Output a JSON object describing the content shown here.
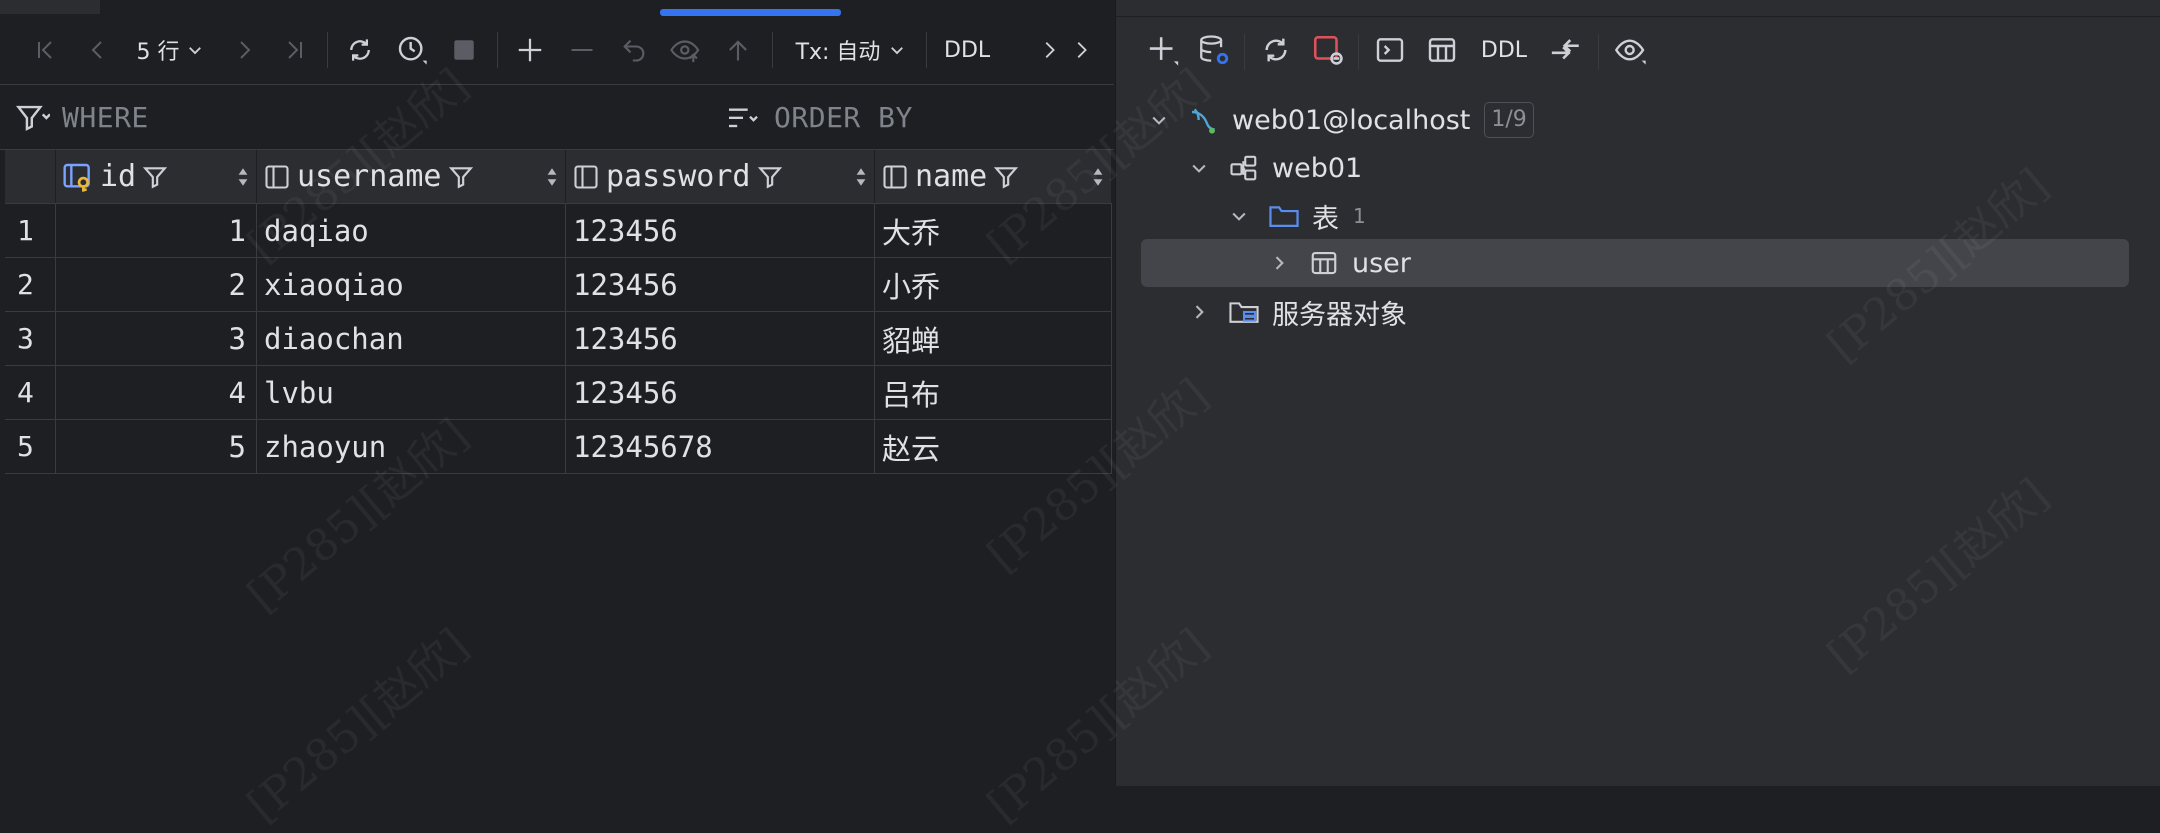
{
  "toolbar": {
    "rows_label": "5 行",
    "tx_label": "Tx: 自动",
    "ddl_label": "DDL"
  },
  "filter": {
    "where_label": "WHERE",
    "order_label": "ORDER BY"
  },
  "grid": {
    "columns": [
      "id",
      "username",
      "password",
      "name"
    ],
    "rows": [
      {
        "n": "1",
        "id": "1",
        "username": "daqiao",
        "password": "123456",
        "name": "大乔"
      },
      {
        "n": "2",
        "id": "2",
        "username": "xiaoqiao",
        "password": "123456",
        "name": "小乔"
      },
      {
        "n": "3",
        "id": "3",
        "username": "diaochan",
        "password": "123456",
        "name": "貂蝉"
      },
      {
        "n": "4",
        "id": "4",
        "username": "lvbu",
        "password": "123456",
        "name": "吕布"
      },
      {
        "n": "5",
        "id": "5",
        "username": "zhaoyun",
        "password": "12345678",
        "name": "赵云"
      }
    ]
  },
  "rtoolbar": {
    "ddl_label": "DDL"
  },
  "tree": {
    "connection": "web01@localhost",
    "connection_badge": "1/9",
    "schema": "web01",
    "tables_folder": "表",
    "tables_count": "1",
    "table_user": "user",
    "server_objects": "服务器对象"
  },
  "watermark": "[P285][赵欣]",
  "colors": {
    "accent": "#3574f0",
    "bg_left": "#1e1f22",
    "bg_right": "#2b2d30",
    "selected": "#43454a",
    "key_icon": "#e8b93b",
    "stop_red": "#e0525b"
  }
}
